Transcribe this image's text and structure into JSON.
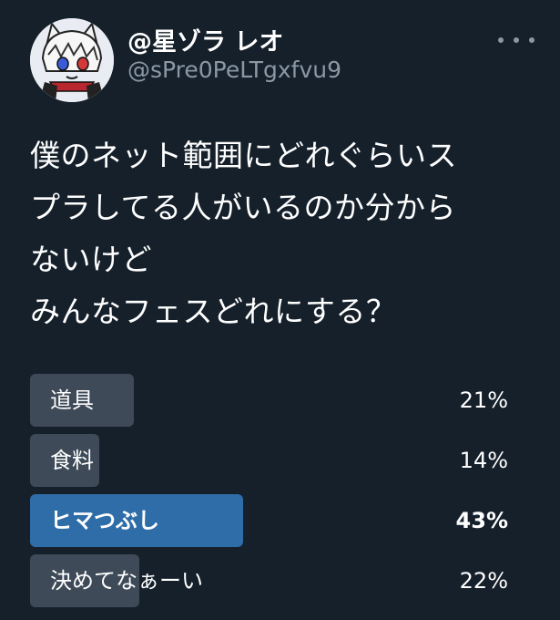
{
  "author": {
    "display_name": "@星ゾラ レオ",
    "handle": "@sPre0PeLTgxfvu9"
  },
  "icons": {
    "more": "more-horizontal-icon",
    "avatar": "avatar"
  },
  "tweet": {
    "text": "僕のネット範囲にどれぐらいス\nプラしてる人がいるのか分から\nないけど\nみんなフェスどれにする？"
  },
  "poll": {
    "options": [
      {
        "label": "道具",
        "percent_text": "21%",
        "percent": 21,
        "winner": false
      },
      {
        "label": "食料",
        "percent_text": "14%",
        "percent": 14,
        "winner": false
      },
      {
        "label": "ヒマつぶし",
        "percent_text": "43%",
        "percent": 43,
        "winner": true
      },
      {
        "label": "決めてなぁーい",
        "percent_text": "22%",
        "percent": 22,
        "winner": false
      }
    ]
  },
  "colors": {
    "background": "#15202b",
    "bar_default": "#3e4a58",
    "bar_winner": "#2f6da8",
    "secondary_text": "#8b98a5"
  }
}
